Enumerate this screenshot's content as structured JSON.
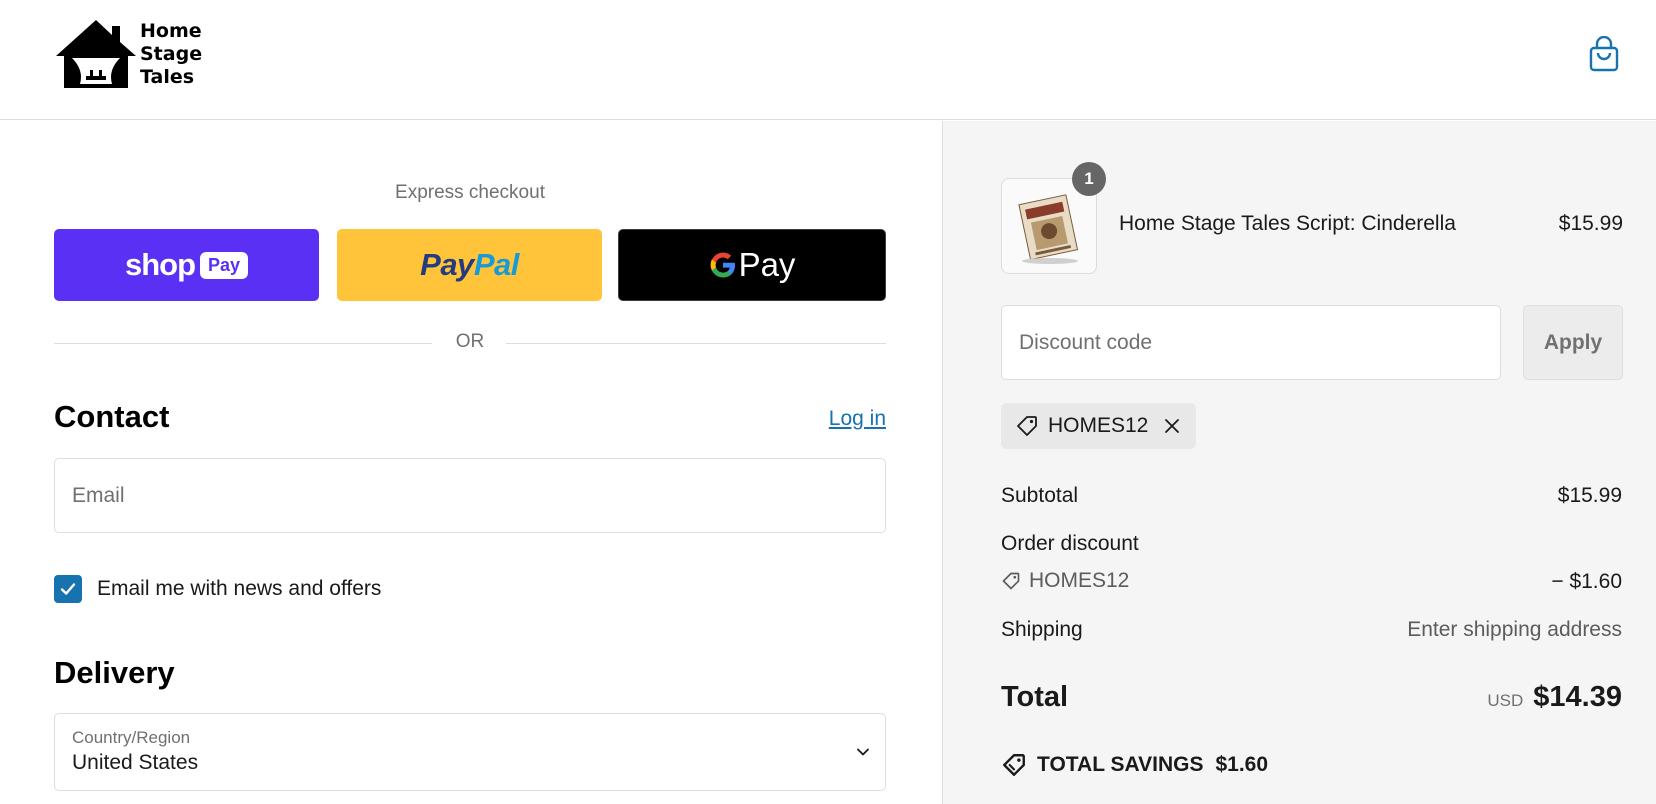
{
  "header": {
    "logo_line1": "Home",
    "logo_line2": "Stage",
    "logo_line3": "Tales",
    "cart_icon": "shopping-bag-icon"
  },
  "express": {
    "title": "Express checkout",
    "shop_pay_word": "shop",
    "shop_pay_pill": "Pay",
    "paypal_dark": "Pay",
    "paypal_light": "Pal",
    "gpay_word": "Pay",
    "or_label": "OR"
  },
  "contact": {
    "heading": "Contact",
    "login_label": "Log in",
    "email_placeholder": "Email",
    "newsletter_label": "Email me with news and offers",
    "newsletter_checked": true
  },
  "delivery": {
    "heading": "Delivery",
    "country_caption": "Country/Region",
    "country_value": "United States"
  },
  "summary": {
    "item": {
      "quantity": "1",
      "name": "Home Stage Tales Script: Cinderella",
      "price": "$15.99"
    },
    "discount_placeholder": "Discount code",
    "apply_label": "Apply",
    "applied_code": "HOMES12",
    "subtotal_label": "Subtotal",
    "subtotal_value": "$15.99",
    "order_discount_label": "Order discount",
    "discount_code": "HOMES12",
    "discount_value": "− $1.60",
    "shipping_label": "Shipping",
    "shipping_value": "Enter shipping address",
    "total_label": "Total",
    "currency": "USD",
    "total_value": "$14.39",
    "savings_label": "TOTAL SAVINGS",
    "savings_value": "$1.60"
  },
  "colors": {
    "accent": "#1773b0",
    "shop_pay": "#5a31f4",
    "paypal": "#ffc439",
    "summary_bg": "#f5f5f5"
  }
}
